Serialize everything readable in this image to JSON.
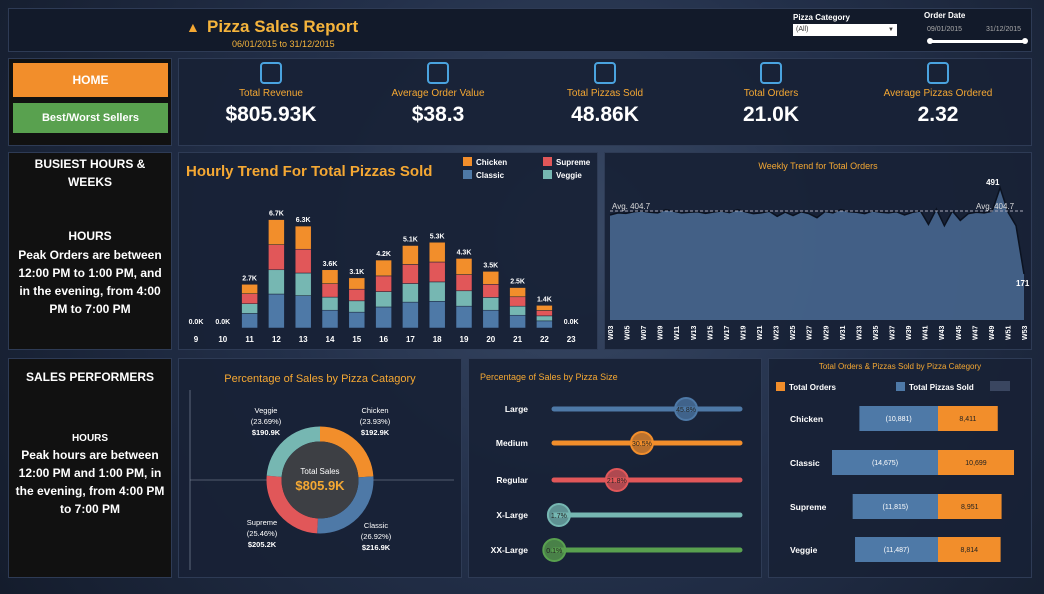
{
  "header": {
    "title": "Pizza Sales Report",
    "date_range": "06/01/2015 to 31/12/2015",
    "category_label": "Pizza Category",
    "category_value": "(All)",
    "date_label": "Order Date",
    "date_from": "09/01/2015",
    "date_to": "31/12/2015"
  },
  "nav": {
    "home": "HOME",
    "best_worst": "Best/Worst Sellers"
  },
  "kpis": [
    {
      "label": "Total Revenue",
      "value": "$805.93K",
      "icon": "money-icon"
    },
    {
      "label": "Average Order Value",
      "value": "$38.3",
      "icon": "wallet-icon"
    },
    {
      "label": "Total Pizzas Sold",
      "value": "48.86K",
      "icon": "receipt-icon"
    },
    {
      "label": "Total Orders",
      "value": "21.0K",
      "icon": "delivery-icon"
    },
    {
      "label": "Average Pizzas Ordered",
      "value": "2.32",
      "icon": "box-icon"
    }
  ],
  "busiest": {
    "title": "BUSIEST HOURS & WEEKS",
    "sub": "HOURS",
    "text": "Peak Orders are between 12:00 PM to 1:00 PM, and in the evening, from 4:00 PM to 7:00 PM"
  },
  "sales": {
    "title": "SALES PERFORMERS",
    "sub": "HOURS",
    "text": "Peak hours are between 12:00 PM and 1:00 PM, in the evening, from 4:00 PM to 7:00 PM"
  },
  "colors": {
    "chicken": "#f28e2b",
    "supreme": "#e15759",
    "classic": "#4e79a7",
    "veggie": "#76b7b2",
    "accent": "#f5a833"
  },
  "chart_data": [
    {
      "type": "bar",
      "title": "Hourly Trend For Total Pizzas Sold",
      "stacked": true,
      "categories": [
        "9",
        "10",
        "11",
        "12",
        "13",
        "14",
        "15",
        "16",
        "17",
        "18",
        "19",
        "20",
        "21",
        "22",
        "23"
      ],
      "totals": [
        "0.0K",
        "0.0K",
        "2.7K",
        "6.7K",
        "6.3K",
        "3.6K",
        "3.1K",
        "4.2K",
        "5.1K",
        "5.3K",
        "4.3K",
        "3.5K",
        "2.5K",
        "1.4K",
        "0.0K"
      ],
      "series": [
        {
          "name": "Classic",
          "values": [
            0,
            0,
            900,
            2100,
            2000,
            1100,
            980,
            1300,
            1600,
            1650,
            1350,
            1100,
            790,
            440,
            0
          ]
        },
        {
          "name": "Veggie",
          "values": [
            0,
            0,
            600,
            1500,
            1400,
            810,
            700,
            950,
            1150,
            1200,
            950,
            790,
            560,
            310,
            0
          ]
        },
        {
          "name": "Supreme",
          "values": [
            0,
            0,
            620,
            1550,
            1470,
            830,
            720,
            970,
            1180,
            1230,
            1000,
            810,
            580,
            330,
            0
          ]
        },
        {
          "name": "Chicken",
          "values": [
            0,
            0,
            580,
            1550,
            1430,
            860,
            700,
            980,
            1170,
            1220,
            1000,
            800,
            570,
            320,
            0
          ]
        }
      ],
      "legend": [
        "Chicken",
        "Supreme",
        "Classic",
        "Veggie"
      ]
    },
    {
      "type": "area",
      "title": "Weekly Trend for Total Orders",
      "avg_label": "Avg. 404.7",
      "avg": 404.7,
      "max_label": "491",
      "min_label": "171",
      "x": [
        "W03",
        "W05",
        "W07",
        "W09",
        "W11",
        "W13",
        "W15",
        "W17",
        "W19",
        "W21",
        "W23",
        "W25",
        "W27",
        "W29",
        "W31",
        "W33",
        "W35",
        "W37",
        "W39",
        "W41",
        "W43",
        "W45",
        "W47",
        "W49",
        "W51",
        "W53"
      ],
      "values": [
        390,
        398,
        396,
        402,
        405,
        400,
        398,
        410,
        404,
        398,
        400,
        402,
        396,
        401,
        405,
        399,
        410,
        402,
        395,
        398,
        404,
        385,
        401,
        388,
        402,
        395,
        380,
        403,
        398,
        410,
        402,
        400,
        395,
        405,
        400,
        398,
        402,
        390,
        400,
        405,
        355,
        412,
        350,
        405,
        370,
        395,
        400,
        398,
        404,
        491,
        400,
        350,
        171
      ],
      "ylim": [
        0,
        520
      ]
    },
    {
      "type": "pie",
      "title": "Percentage of Sales by Pizza Catagory",
      "center_label": "Total Sales",
      "center_value": "$805.9K",
      "slices": [
        {
          "name": "Chicken",
          "pct": 23.93,
          "pct_label": "(23.93%)",
          "value": "$192.9K"
        },
        {
          "name": "Classic",
          "pct": 26.92,
          "pct_label": "(26.92%)",
          "value": "$216.9K"
        },
        {
          "name": "Supreme",
          "pct": 25.46,
          "pct_label": "(25.46%)",
          "value": "$205.2K"
        },
        {
          "name": "Veggie",
          "pct": 23.69,
          "pct_label": "(23.69%)",
          "value": "$190.9K"
        }
      ]
    },
    {
      "type": "bar",
      "title": "Percentage of Sales by Pizza Size",
      "categories": [
        "Large",
        "Medium",
        "Regular",
        "X-Large",
        "XX-Large"
      ],
      "values": [
        45.8,
        30.5,
        21.8,
        1.7,
        0.1
      ],
      "labels": [
        "45.8%",
        "30.5%",
        "21.8%",
        "1.7%",
        "0.1%"
      ],
      "colors": [
        "#4e79a7",
        "#f28e2b",
        "#e15759",
        "#76b7b2",
        "#59a14f"
      ]
    },
    {
      "type": "bar",
      "title": "Total Orders & Pizzas Sold by Pizza Category",
      "legend": [
        "Total Orders",
        "Total Pizzas Sold"
      ],
      "categories": [
        "Chicken",
        "Classic",
        "Supreme",
        "Veggie"
      ],
      "orders": [
        10881,
        14675,
        11815,
        11487
      ],
      "orders_labels": [
        "(10,881)",
        "(14,675)",
        "(11,815)",
        "(11,487)"
      ],
      "pizzas": [
        8411,
        10699,
        8951,
        8814
      ],
      "pizzas_labels": [
        "8,411",
        "10,699",
        "8,951",
        "8,814"
      ]
    }
  ]
}
